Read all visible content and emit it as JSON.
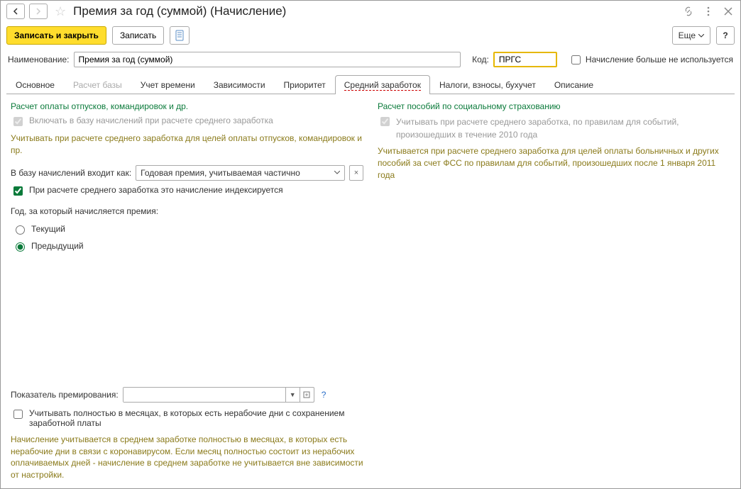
{
  "header": {
    "title": "Премия за год (суммой) (Начисление)"
  },
  "toolbar": {
    "save_close": "Записать и закрыть",
    "save": "Записать",
    "more": "Еще",
    "help": "?"
  },
  "form": {
    "name_label": "Наименование:",
    "name_value": "Премия за год (суммой)",
    "code_label": "Код:",
    "code_value": "ПРГС",
    "not_used_label": "Начисление больше не используется"
  },
  "tabs": [
    {
      "label": "Основное"
    },
    {
      "label": "Расчет базы"
    },
    {
      "label": "Учет времени"
    },
    {
      "label": "Зависимости"
    },
    {
      "label": "Приоритет"
    },
    {
      "label": "Средний заработок"
    },
    {
      "label": "Налоги, взносы, бухучет"
    },
    {
      "label": "Описание"
    }
  ],
  "left": {
    "section_title": "Расчет оплаты отпусков, командировок и др.",
    "include_base": "Включать в базу начислений при расчете среднего заработка",
    "note1": "Учитывать при расчете среднего заработка для целей оплаты отпусков, командировок и пр.",
    "base_label": "В базу начислений входит как:",
    "base_value": "Годовая премия, учитываемая частично",
    "index_label": "При расчете среднего заработка это начисление индексируется",
    "year_label": "Год, за который начисляется премия:",
    "radio_current": "Текущий",
    "radio_prev": "Предыдущий",
    "indicator_label": "Показатель премирования:",
    "full_months_label": "Учитывать полностью в месяцах, в которых есть нерабочие дни с сохранением заработной платы",
    "note2": "Начисление учитывается в среднем заработке полностью в месяцах, в которых есть нерабочие дни в связи с коронавирусом. Если месяц полностью состоит из нерабочих оплачиваемых дней - начисление в среднем заработке не учитывается вне зависимости от настройки."
  },
  "right": {
    "section_title": "Расчет пособий по социальному страхованию",
    "include_label": "Учитывать при расчете среднего заработка, по правилам для событий, произошедших в течение 2010 года",
    "note": "Учитывается при расчете среднего заработка для целей оплаты больничных и других пособий за счет ФСС по правилам для событий, произошедших после 1 января 2011 года"
  }
}
